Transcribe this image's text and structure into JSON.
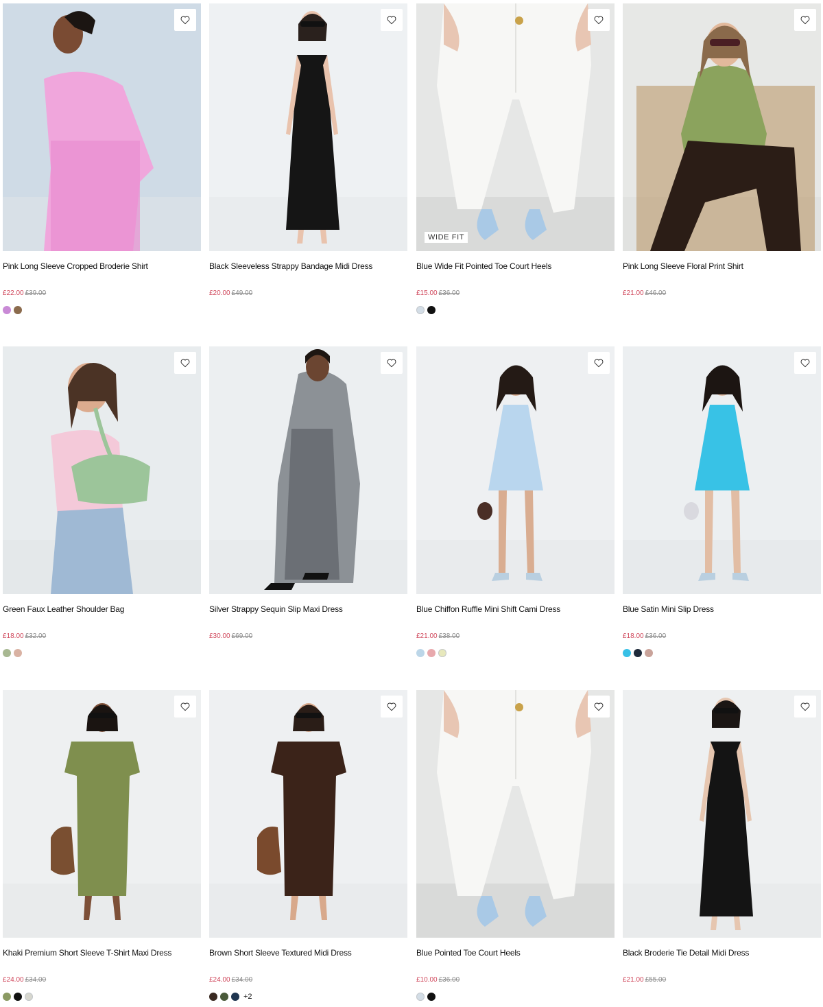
{
  "wishlist_icon": "heart-outline-icon",
  "products": [
    {
      "title": "Pink Long Sleeve Cropped Broderie Shirt",
      "price": "£22.00",
      "was": "£39.00",
      "swatches": [
        "#c98ad6",
        "#8b6b4d"
      ],
      "badge": "",
      "more": "",
      "image": {
        "bg": "#cfdbe6",
        "floor": "#d8e0e7",
        "garment": "#f0a6dc",
        "accent": "#e88fd0",
        "skin": "#7a4b33",
        "hair": "#1b1512",
        "kind": "shirt-profile"
      }
    },
    {
      "title": "Black Sleeveless Strappy Bandage Midi Dress",
      "price": "£20.00",
      "was": "£49.00",
      "swatches": [],
      "badge": "",
      "more": "",
      "image": {
        "bg": "#eef1f3",
        "floor": "#e9ecee",
        "garment": "#151515",
        "accent": "#151515",
        "skin": "#e9c3ad",
        "hair": "#2a211d",
        "kind": "dress-long"
      }
    },
    {
      "title": "Blue Wide Fit Pointed Toe Court Heels",
      "price": "£15.00",
      "was": "£36.00",
      "swatches": [
        "#d3dde6",
        "#111111"
      ],
      "badge": "WIDE FIT",
      "more": "",
      "image": {
        "bg": "#e6e7e6",
        "floor": "#d9dad9",
        "garment": "#f7f7f5",
        "accent": "#a9c9e6",
        "skin": "#e8c6b3",
        "hair": "#1a1a1a",
        "kind": "jeans-heels"
      }
    },
    {
      "title": "Pink Long Sleeve Floral Print Shirt",
      "price": "£21.00",
      "was": "£46.00",
      "swatches": [],
      "badge": "",
      "more": "",
      "image": {
        "bg": "#e7e8e6",
        "floor": "#e1e2e0",
        "garment": "#8ba35d",
        "accent": "#2b1d16",
        "skin": "#e2b99c",
        "hair": "#8a6a4b",
        "kind": "seated"
      }
    },
    {
      "title": "Green Faux Leather Shoulder Bag",
      "price": "£18.00",
      "was": "£32.00",
      "swatches": [
        "#a8b892",
        "#d9b2a3"
      ],
      "badge": "",
      "more": "",
      "image": {
        "bg": "#e8ecee",
        "floor": "#e4e8ea",
        "garment": "#f4c9d9",
        "accent": "#9cc59a",
        "skin": "#dcab8e",
        "hair": "#4b3325",
        "kind": "bag"
      }
    },
    {
      "title": "Silver Strappy Sequin Slip Maxi Dress",
      "price": "£30.00",
      "was": "£69.00",
      "swatches": [],
      "badge": "",
      "more": "",
      "image": {
        "bg": "#eceff1",
        "floor": "#e8ebed",
        "garment": "#8c9196",
        "accent": "#5d6166",
        "skin": "#6b4531",
        "hair": "#1d1612",
        "kind": "coat-long"
      }
    },
    {
      "title": "Blue Chiffon Ruffle Mini Shift Cami Dress",
      "price": "£21.00",
      "was": "£38.00",
      "swatches": [
        "#bcd6e8",
        "#e8a9ad",
        "#e7e8bc"
      ],
      "badge": "",
      "more": "",
      "image": {
        "bg": "#eef0f2",
        "floor": "#e9ebed",
        "garment": "#b9d6ee",
        "accent": "#4a2e26",
        "skin": "#d9ad91",
        "hair": "#241a15",
        "kind": "mini-dress"
      }
    },
    {
      "title": "Blue Satin Mini Slip Dress",
      "price": "£18.00",
      "was": "£36.00",
      "swatches": [
        "#38c0e6",
        "#1e2a3a",
        "#c9a39a"
      ],
      "badge": "",
      "more": "",
      "image": {
        "bg": "#eceff1",
        "floor": "#e7eaec",
        "garment": "#38c2e6",
        "accent": "#d9d9df",
        "skin": "#e2bda4",
        "hair": "#1c1512",
        "kind": "mini-dress"
      }
    },
    {
      "title": "Khaki Premium Short Sleeve T-Shirt Maxi Dress",
      "price": "£24.00",
      "was": "£34.00",
      "swatches": [
        "#8b9a63",
        "#111111",
        "#d7d7cf"
      ],
      "badge": "",
      "more": "",
      "image": {
        "bg": "#eef0f1",
        "floor": "#e9ebec",
        "garment": "#7f8f4e",
        "accent": "#7a4f31",
        "skin": "#7d5038",
        "hair": "#1a1411",
        "kind": "tee-dress"
      }
    },
    {
      "title": "Brown Short Sleeve Textured Midi Dress",
      "price": "£24.00",
      "was": "£34.00",
      "swatches": [
        "#3a2a22",
        "#4a5a3a",
        "#1f3550"
      ],
      "badge": "",
      "more": "+2",
      "image": {
        "bg": "#eef0f2",
        "floor": "#e9ebed",
        "garment": "#3b2319",
        "accent": "#7a4a2d",
        "skin": "#d8a98c",
        "hair": "#2a1d17",
        "kind": "tee-dress"
      }
    },
    {
      "title": "Blue Pointed Toe Court Heels",
      "price": "£10.00",
      "was": "£36.00",
      "swatches": [
        "#d3dde6",
        "#111111"
      ],
      "badge": "",
      "more": "",
      "image": {
        "bg": "#e6e7e6",
        "floor": "#d9dad9",
        "garment": "#f7f7f5",
        "accent": "#a9c9e6",
        "skin": "#e8c6b3",
        "hair": "#1a1a1a",
        "kind": "jeans-heels"
      }
    },
    {
      "title": "Black Broderie Tie Detail Midi Dress",
      "price": "£21.00",
      "was": "£55.00",
      "swatches": [],
      "badge": "",
      "more": "",
      "image": {
        "bg": "#eef0f1",
        "floor": "#e9ebec",
        "garment": "#141414",
        "accent": "#f2f2f2",
        "skin": "#e6c6b0",
        "hair": "#1b1614",
        "kind": "dress-long"
      }
    }
  ]
}
